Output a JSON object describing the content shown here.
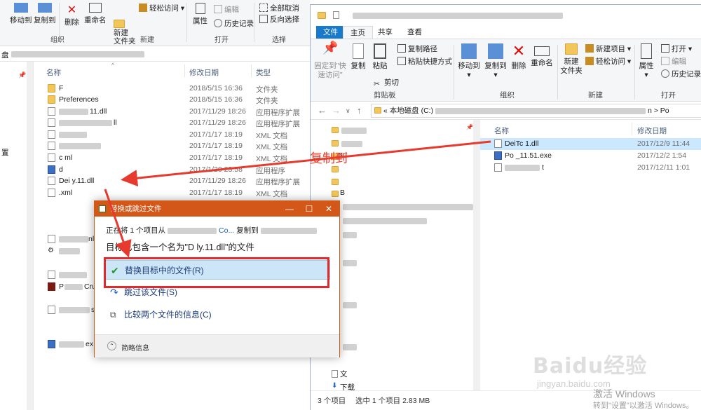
{
  "left_window": {
    "ribbon": {
      "move_to": "移动到",
      "copy_to": "复制到",
      "delete": "删除",
      "rename": "重命名",
      "new_folder": "新建\n文件夹",
      "easy_access": "轻松访问",
      "properties": "属性",
      "edit": "编辑",
      "history": "历史记录",
      "select_all": "全部取消",
      "invert": "反向选择",
      "group_organize": "组织",
      "group_new": "新建",
      "group_open": "打开",
      "group_select": "选择"
    },
    "address_prefix": "盘",
    "columns": {
      "name": "名称",
      "date": "修改日期",
      "type": "类型"
    },
    "rows": [
      {
        "name": "F",
        "date": "2018/5/15 16:36",
        "type": "文件夹",
        "icon": "folder"
      },
      {
        "name": "Preferences",
        "date": "2018/5/15 16:36",
        "type": "文件夹",
        "icon": "folder"
      },
      {
        "name": "11.dll",
        "date": "2017/11/29 18:26",
        "type": "应用程序扩展",
        "icon": "doc"
      },
      {
        "name": "ll",
        "date": "2017/11/29 18:26",
        "type": "应用程序扩展",
        "icon": "doc"
      },
      {
        "name": "",
        "date": "2017/1/17 18:19",
        "type": "XML 文档",
        "icon": "doc"
      },
      {
        "name": "",
        "date": "2017/1/17 18:19",
        "type": "XML 文档",
        "icon": "doc"
      },
      {
        "name": "c  ml",
        "date": "2017/1/17 18:19",
        "type": "XML 文档",
        "icon": "doc"
      },
      {
        "name": "d",
        "date": "2017/1/20 23:58",
        "type": "应用程序",
        "icon": "exe"
      },
      {
        "name": "Dei  y.11.dll",
        "date": "2017/11/29 18:26",
        "type": "应用程序扩展",
        "icon": "doc"
      },
      {
        "name": "  .xml",
        "date": "2017/1/17 18:19",
        "type": "XML 文档",
        "icon": "doc"
      }
    ],
    "more_rows": [
      "nl",
      "",
      "Cru",
      "s",
      "ex"
    ],
    "nav_label": "置"
  },
  "right_window": {
    "tabs": {
      "file": "文件",
      "home": "主页",
      "share": "共享",
      "view": "查看"
    },
    "ribbon": {
      "pin": "固定到\"快\n速访问\"",
      "copy": "复制",
      "paste": "粘贴",
      "copy_path": "复制路径",
      "paste_shortcut": "粘贴快捷方式",
      "cut": "剪切",
      "move_to": "移动到",
      "copy_to": "复制到",
      "delete": "删除",
      "rename": "重命名",
      "new_folder": "新建\n文件夹",
      "new_item": "新建项目",
      "easy_access": "轻松访问",
      "properties": "属性",
      "open": "打开",
      "edit": "编辑",
      "history": "历史记录",
      "group_clipboard": "剪贴板",
      "group_organize": "组织",
      "group_new": "新建",
      "group_open": "打开"
    },
    "address": {
      "prefix": "«",
      "drive": "本地磁盘 (C:)",
      "tail": "n",
      "end": "Po"
    },
    "columns": {
      "name": "名称",
      "date": "修改日期"
    },
    "files": [
      {
        "name": "DeiTc  1.dll",
        "date": "2017/12/9 11:44",
        "icon": "doc",
        "selected": true
      },
      {
        "name": "Po  _11.51.exe",
        "date": "2017/12/2 1:54",
        "icon": "exe",
        "selected": false
      },
      {
        "name": "t",
        "date": "2017/12/11 1:01",
        "icon": "doc",
        "selected": false
      }
    ],
    "nav_items": [
      "ort",
      "B",
      "文",
      "下载"
    ],
    "status": {
      "count": "3 个项目",
      "selected": "选中 1 个项目 2.83 MB"
    }
  },
  "dialog": {
    "title": "替换或跳过文件",
    "line1_prefix": "正在将 1 个项目从",
    "line1_src": "Co...",
    "line1_mid": "复制到",
    "line2": "目标已包含一个名为\"D  ly.11.dll\"的文件",
    "option_replace": "替换目标中的文件(R)",
    "option_skip": "跳过该文件(S)",
    "option_compare": "比较两个文件的信息(C)",
    "footer": "简略信息"
  },
  "annotation": {
    "callout": "复制到",
    "arrow_color": "#e63a2e"
  },
  "watermark": {
    "brand": "Baidu经验",
    "url": "jingyan.baidu.com",
    "activate_1": "激活 Windows",
    "activate_2": "转到\"设置\"以激活 Windows。"
  }
}
